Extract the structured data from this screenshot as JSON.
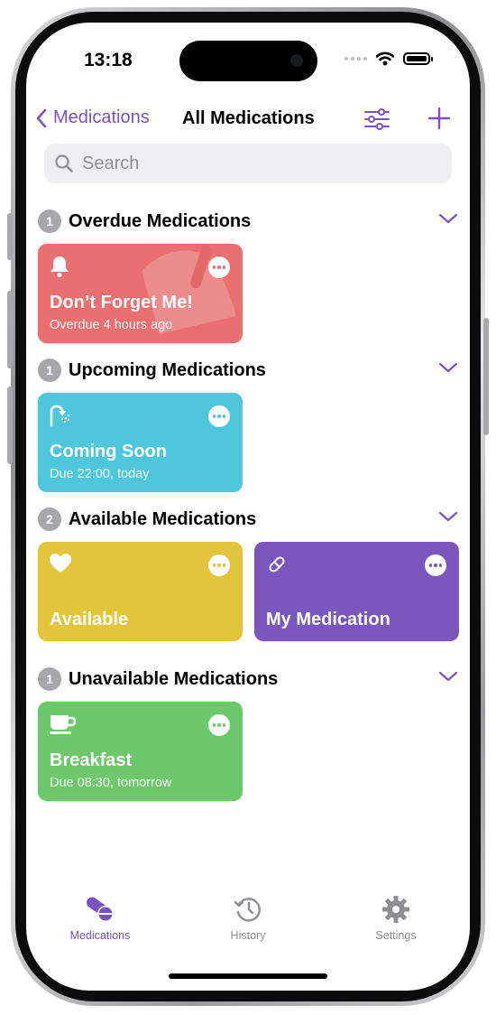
{
  "status": {
    "time": "13:18"
  },
  "nav": {
    "back_label": "Medications",
    "title": "All Medications"
  },
  "search": {
    "placeholder": "Search",
    "value": ""
  },
  "colors": {
    "accent": "#7b52c1",
    "overdue": "#e96f71",
    "upcoming": "#4ec7dc",
    "available": "#e3c53c",
    "purple": "#7b56bd",
    "unavailable": "#6cc86a",
    "badge": "#a7a7ab"
  },
  "sections": [
    {
      "count": "1",
      "title": "Overdue Medications",
      "cards": [
        {
          "name": "Don’t Forget Me!",
          "subtitle": "Overdue 4 hours ago",
          "icon": "bell-icon"
        }
      ]
    },
    {
      "count": "1",
      "title": "Upcoming Medications",
      "cards": [
        {
          "name": "Coming Soon",
          "subtitle": "Due 22:00, today",
          "icon": "shower-icon"
        }
      ]
    },
    {
      "count": "2",
      "title": "Available Medications",
      "cards": [
        {
          "name": "Available",
          "icon": "heart-icon"
        },
        {
          "name": "My Medication",
          "icon": "pill-icon"
        }
      ]
    },
    {
      "count": "1",
      "title": "Unavailable Medications",
      "cards": [
        {
          "name": "Breakfast",
          "subtitle": "Due 08:30, tomorrow",
          "icon": "coffee-cup-icon"
        }
      ]
    }
  ],
  "tabs": [
    {
      "label": "Medications",
      "icon": "pills-icon",
      "active": true
    },
    {
      "label": "History",
      "icon": "clock-history-icon",
      "active": false
    },
    {
      "label": "Settings",
      "icon": "gear-icon",
      "active": false
    }
  ]
}
